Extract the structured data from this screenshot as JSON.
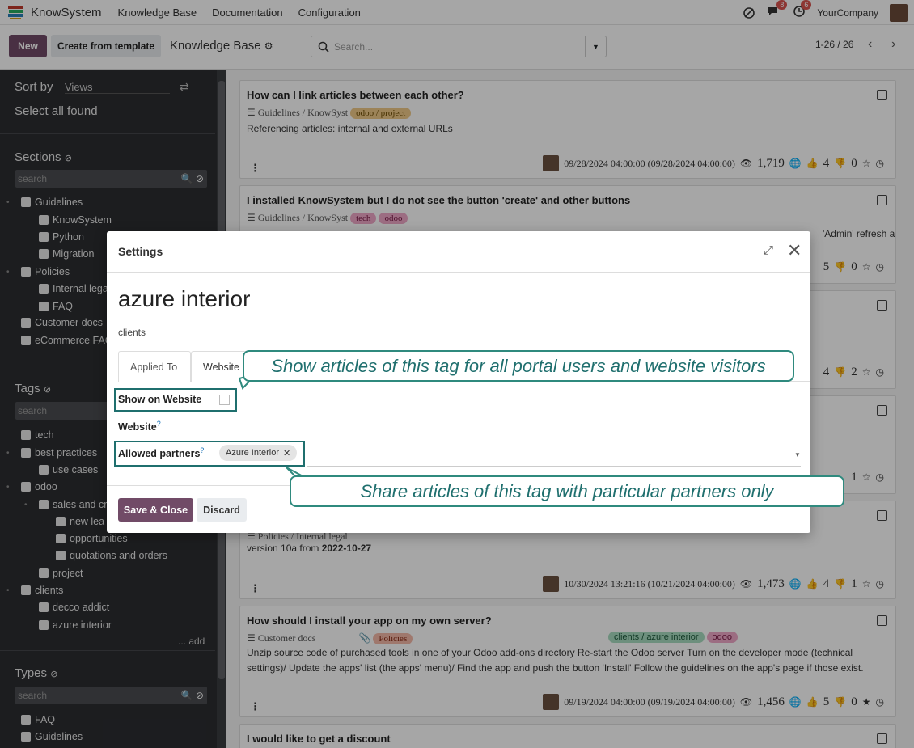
{
  "nav": {
    "brand": "KnowSystem",
    "menus": [
      "Knowledge Base",
      "Documentation",
      "Configuration"
    ],
    "messages_count": "8",
    "activities_count": "6",
    "company": "YourCompany"
  },
  "control": {
    "new_label": "New",
    "template_label": "Create from template",
    "title": "Knowledge Base",
    "search_placeholder": "Search...",
    "pager": "1-26 / 26"
  },
  "sidebar": {
    "sort_label": "Sort by",
    "sort_value": "Views",
    "select_all": "Select all found",
    "sections_title": "Sections",
    "sections_search": "search",
    "sections": [
      "Guidelines",
      "KnowSystem",
      "Python",
      "Migration",
      "Policies",
      "Internal lega",
      "FAQ",
      "Customer docs",
      "eCommerce FAQ"
    ],
    "tags_title": "Tags",
    "tags_search": "search",
    "tags": [
      "tech",
      "best practices",
      "use cases",
      "odoo",
      "sales and cr",
      "new lea",
      "opportunities",
      "quotations and orders",
      "project",
      "clients",
      "decco addict",
      "azure interior"
    ],
    "add_label": "... add",
    "types_title": "Types",
    "types_search": "search",
    "types": [
      "FAQ",
      "Guidelines"
    ]
  },
  "articles": [
    {
      "title": "How can I link articles between each other?",
      "path": "Guidelines / KnowSyst",
      "tags": [
        "odoo / project"
      ],
      "desc": "Referencing articles: internal and external URLs",
      "date": "09/28/2024 04:00:00 (09/28/2024 04:00:00)",
      "views": "1,719",
      "likes": "4",
      "dislikes": "0"
    },
    {
      "title": "I installed KnowSystem but I do not see the button 'create' and other buttons",
      "path": "Guidelines / KnowSyst",
      "tags": [
        "tech",
        "odoo"
      ],
      "desc": "'Admin' refresh a",
      "likes_tail": "5",
      "dislikes": "0"
    },
    {
      "views_tail": "4",
      "dislikes": "2"
    },
    {
      "likes_tail": "1"
    },
    {
      "path": "Policies / Internal legal",
      "desc": "version 10a from",
      "desc_bold": "2022-10-27",
      "date": "10/30/2024 13:21:16 (10/21/2024 04:00:00)",
      "views": "1,473",
      "likes": "4",
      "dislikes": "1"
    },
    {
      "title": "How should I install your app on my own server?",
      "path": "Customer docs",
      "tags": [
        "Policies"
      ],
      "right_tags": [
        "clients / azure interior",
        "odoo"
      ],
      "desc": "Unzip source code of purchased tools in one of your Odoo add-ons directory Re-start the Odoo server Turn on the developer mode (technical settings)/ Update the apps' list (the apps' menu)/ Find the app and push the button 'Install' Follow the guidelines on the app's page if those exist.",
      "date": "09/19/2024 04:00:00 (09/19/2024 04:00:00)",
      "views": "1,456",
      "likes": "5",
      "dislikes": "0"
    },
    {
      "title": "I would like to get a discount"
    }
  ],
  "modal": {
    "title": "Settings",
    "record_name": "azure interior",
    "record_parent": "clients",
    "tabs": [
      "Applied To",
      "Website"
    ],
    "show_on_website_label": "Show on Website",
    "website_label": "Website",
    "allowed_partners_label": "Allowed partners",
    "partner_tag": "Azure Interior",
    "save_label": "Save & Close",
    "discard_label": "Discard"
  },
  "callouts": {
    "website": "Show articles of this tag for all portal users and website visitors",
    "partners": "Share articles of this tag with particular partners only"
  },
  "colors": {
    "brand": "#714b67",
    "callout": "#2f8a7e",
    "sidebar_bg": "#2b2d31"
  }
}
